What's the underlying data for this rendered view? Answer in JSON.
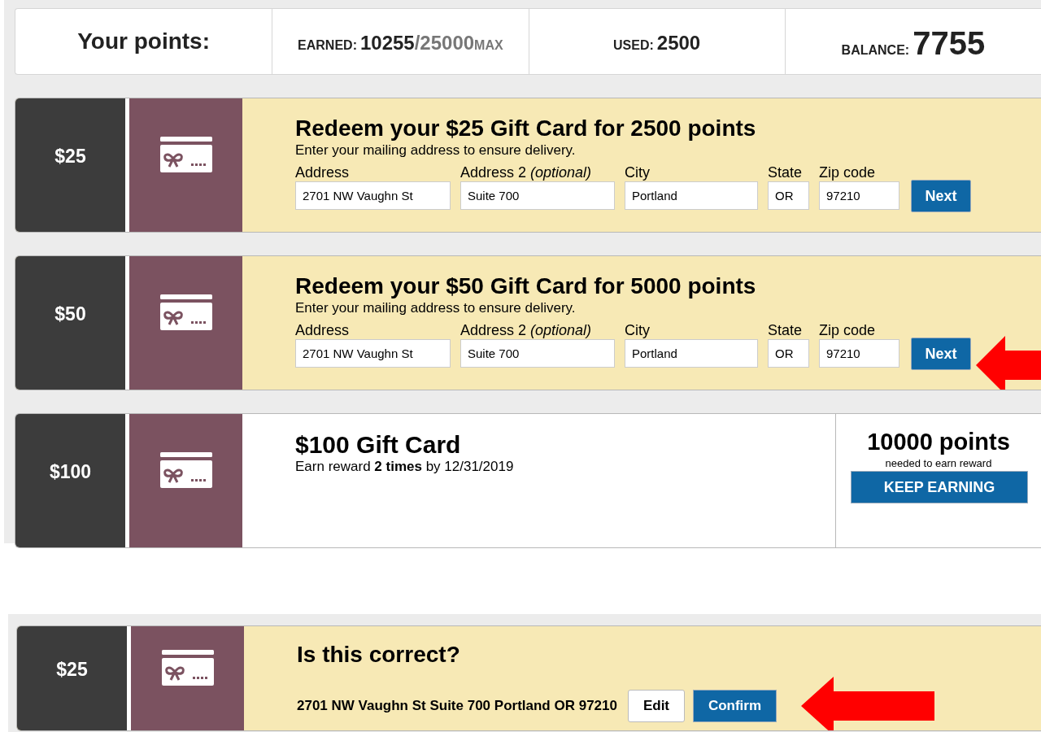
{
  "points": {
    "label": "Your points:",
    "earned_label": "EARNED:",
    "earned": "10255",
    "max": "/25000",
    "max_label": "MAX",
    "used_label": "USED:",
    "used": "2500",
    "balance_label": "BALANCE:",
    "balance": "7755"
  },
  "rewards": [
    {
      "kind": "redeem",
      "amount": "$25",
      "title": "Redeem your $25 Gift Card for 2500 points",
      "subtitle": "Enter your mailing address to ensure delivery.",
      "fields": [
        {
          "label": "Address",
          "value": "2701 NW Vaughn St"
        },
        {
          "label": "Address 2 *(optional)*",
          "value": "Suite 700"
        },
        {
          "label": "City",
          "value": "Portland"
        },
        {
          "label": "State",
          "value": "OR"
        },
        {
          "label": "Zip code",
          "value": "97210"
        }
      ],
      "button": "Next",
      "highlighted": false
    },
    {
      "kind": "redeem",
      "amount": "$50",
      "title": "Redeem your $50 Gift Card for 5000 points",
      "subtitle": "Enter your mailing address to ensure delivery.",
      "fields": [
        {
          "label": "Address",
          "value": "2701 NW Vaughn St"
        },
        {
          "label": "Address 2 *(optional)*",
          "value": "Suite 700"
        },
        {
          "label": "City",
          "value": "Portland"
        },
        {
          "label": "State",
          "value": "OR"
        },
        {
          "label": "Zip code",
          "value": "97210"
        }
      ],
      "button": "Next",
      "highlighted": true
    },
    {
      "kind": "earn",
      "amount": "$100",
      "title": "$100 Gift Card",
      "subtitle": "Earn reward **2 times** by 12/31/2019",
      "points": "10000 points",
      "points_note": "needed to earn reward",
      "button": "KEEP EARNING"
    }
  ],
  "confirmation": {
    "amount": "$25",
    "title": "Is this correct?",
    "address": "2701 NW Vaughn St Suite 700 Portland OR 97210",
    "edit_button": "Edit",
    "confirm_button": "Confirm",
    "highlighted": true
  }
}
